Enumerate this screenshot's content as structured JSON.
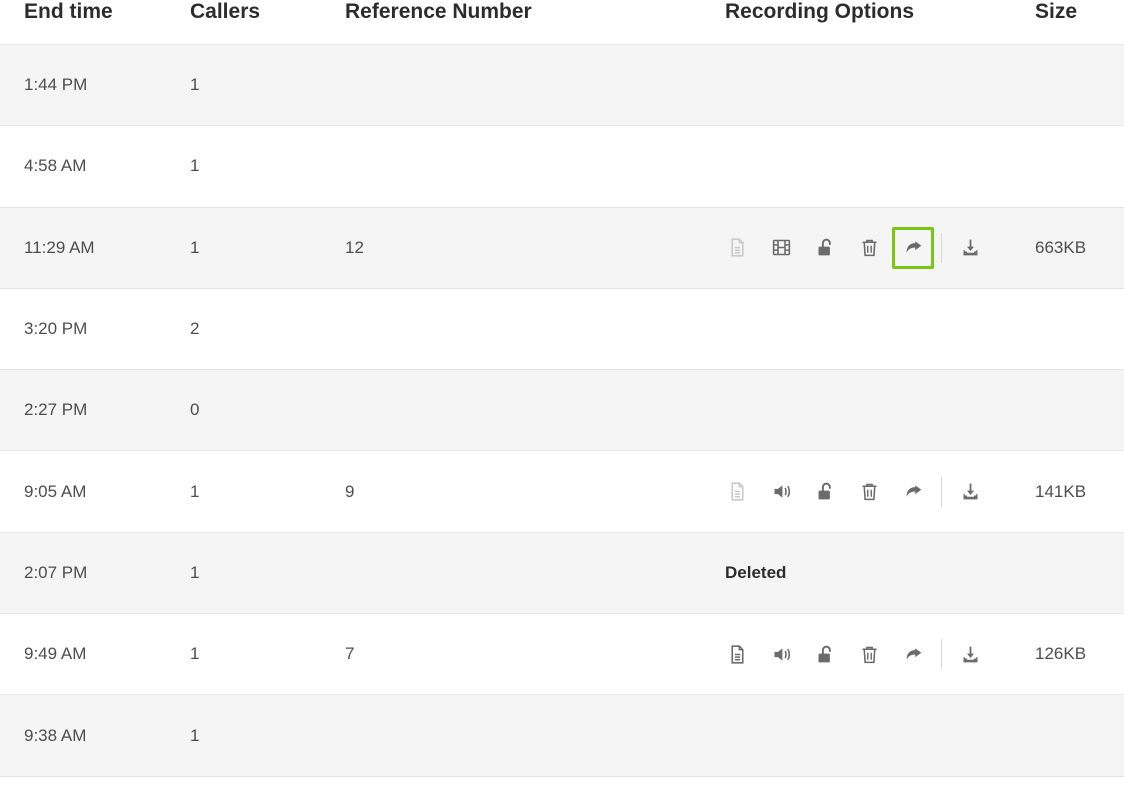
{
  "headers": {
    "end_time": "End time",
    "callers": "Callers",
    "reference": "Reference Number",
    "recording": "Recording Options",
    "size": "Size"
  },
  "rows": [
    {
      "end_time": "1:44 PM",
      "callers": "1",
      "reference": "",
      "recording_type": "none",
      "size": ""
    },
    {
      "end_time": "4:58 AM",
      "callers": "1",
      "reference": "",
      "recording_type": "none",
      "size": ""
    },
    {
      "end_time": "11:29 AM",
      "callers": "1",
      "reference": "12",
      "recording_type": "video",
      "size": "663KB",
      "highlight_share": true
    },
    {
      "end_time": "3:20 PM",
      "callers": "2",
      "reference": "",
      "recording_type": "none",
      "size": ""
    },
    {
      "end_time": "2:27 PM",
      "callers": "0",
      "reference": "",
      "recording_type": "none",
      "size": ""
    },
    {
      "end_time": "9:05 AM",
      "callers": "1",
      "reference": "9",
      "recording_type": "audio",
      "size": "141KB",
      "doc_light": true
    },
    {
      "end_time": "2:07 PM",
      "callers": "1",
      "reference": "",
      "recording_type": "deleted",
      "deleted_label": "Deleted",
      "size": ""
    },
    {
      "end_time": "9:49 AM",
      "callers": "1",
      "reference": "7",
      "recording_type": "audio",
      "size": "126KB"
    },
    {
      "end_time": "9:38 AM",
      "callers": "1",
      "reference": "",
      "recording_type": "none",
      "size": ""
    }
  ]
}
